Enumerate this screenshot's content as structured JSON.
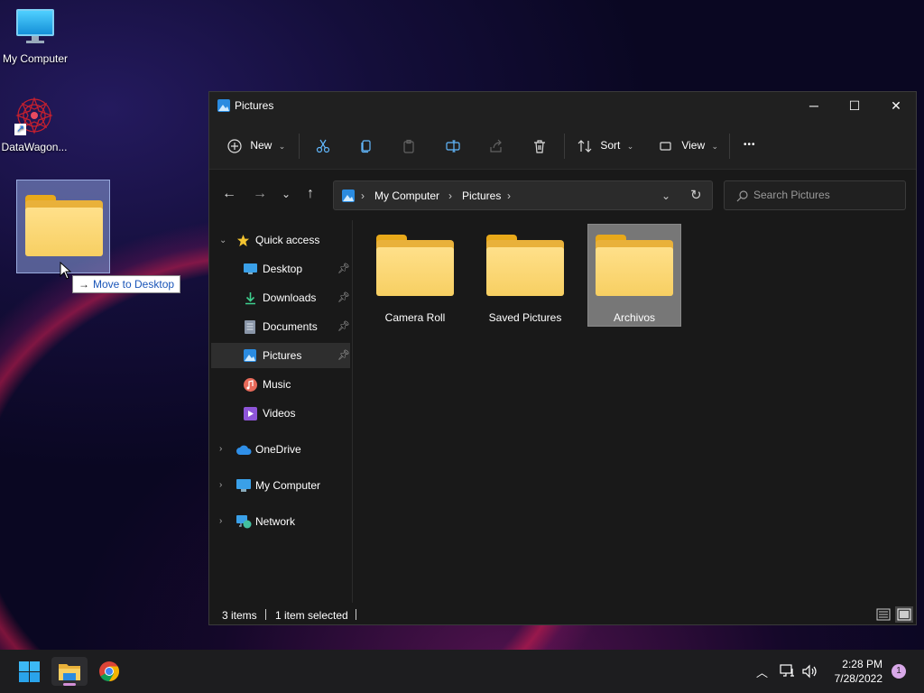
{
  "desktop": {
    "icons": [
      {
        "label": "My Computer"
      },
      {
        "label": "DataWagon..."
      }
    ],
    "drag_tooltip": {
      "arrow": "→",
      "text": "Move to Desktop"
    }
  },
  "window": {
    "title": "Pictures",
    "controls": {
      "minimize": "─",
      "maximize": "☐",
      "close": "✕"
    },
    "toolbar": {
      "new_label": "New",
      "sort_label": "Sort",
      "view_label": "View",
      "more_label": "•••"
    },
    "address": {
      "crumbs": [
        "My Computer",
        "Pictures"
      ],
      "separator": "›"
    },
    "search": {
      "placeholder": "Search Pictures"
    },
    "sidebar": {
      "quick_access": "Quick access",
      "items": [
        {
          "label": "Desktop",
          "pinned": true
        },
        {
          "label": "Downloads",
          "pinned": true
        },
        {
          "label": "Documents",
          "pinned": true
        },
        {
          "label": "Pictures",
          "pinned": true,
          "selected": true
        },
        {
          "label": "Music"
        },
        {
          "label": "Videos"
        }
      ],
      "roots": [
        {
          "label": "OneDrive"
        },
        {
          "label": "My Computer"
        },
        {
          "label": "Network"
        }
      ]
    },
    "content": {
      "items": [
        {
          "name": "Camera Roll"
        },
        {
          "name": "Saved Pictures"
        },
        {
          "name": "Archivos",
          "selected": true
        }
      ]
    },
    "status": {
      "count": "3 items",
      "selection": "1 item selected"
    }
  },
  "taskbar": {
    "clock_time": "2:28 PM",
    "clock_date": "7/28/2022",
    "notification_count": "1"
  },
  "colors": {
    "folder": "#f7cf62",
    "accent": "#60cdff",
    "selection": "#777777"
  }
}
